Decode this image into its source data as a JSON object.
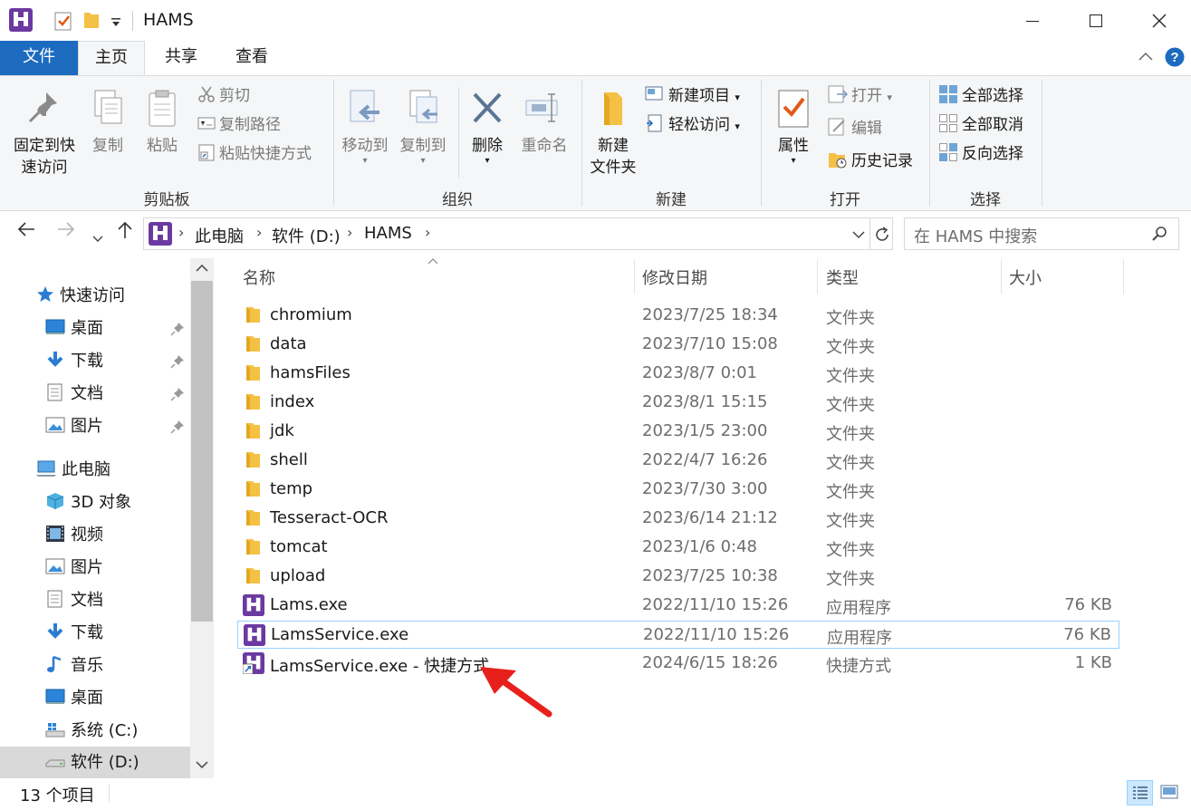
{
  "window": {
    "title": "HAMS"
  },
  "tabs": [
    {
      "label": "文件",
      "kind": "file"
    },
    {
      "label": "主页",
      "kind": "active"
    },
    {
      "label": "共享"
    },
    {
      "label": "查看"
    }
  ],
  "ribbon": {
    "clipboard": {
      "label": "剪贴板",
      "pin_line1": "固定到快",
      "pin_line2": "速访问",
      "copy": "复制",
      "paste": "粘贴",
      "cut": "剪切",
      "copy_path": "复制路径",
      "paste_shortcut": "粘贴快捷方式"
    },
    "organize": {
      "label": "组织",
      "move_to": "移动到",
      "copy_to": "复制到",
      "delete": "删除",
      "rename": "重命名"
    },
    "new": {
      "label": "新建",
      "new_folder_line1": "新建",
      "new_folder_line2": "文件夹",
      "new_item": "新建项目",
      "easy_access": "轻松访问"
    },
    "open": {
      "label": "打开",
      "properties": "属性",
      "open": "打开",
      "edit": "编辑",
      "history": "历史记录"
    },
    "select": {
      "label": "选择",
      "select_all": "全部选择",
      "select_none": "全部取消",
      "invert": "反向选择"
    }
  },
  "address": {
    "crumbs": [
      "此电脑",
      "软件 (D:)",
      "HAMS"
    ],
    "search_placeholder": "在 HAMS 中搜索"
  },
  "nav": {
    "quick_access": "快速访问",
    "quick_items": [
      "桌面",
      "下载",
      "文档",
      "图片"
    ],
    "this_pc": "此电脑",
    "pc_items": [
      "3D 对象",
      "视频",
      "图片",
      "文档",
      "下载",
      "音乐",
      "桌面",
      "系统 (C:)",
      "软件 (D:)"
    ]
  },
  "columns": {
    "name": "名称",
    "date": "修改日期",
    "type": "类型",
    "size": "大小"
  },
  "files": [
    {
      "name": "chromium",
      "date": "2023/7/25 18:34",
      "type": "文件夹",
      "size": "",
      "icon": "folder-icon"
    },
    {
      "name": "data",
      "date": "2023/7/10 15:08",
      "type": "文件夹",
      "size": "",
      "icon": "folder-icon"
    },
    {
      "name": "hamsFiles",
      "date": "2023/8/7 0:01",
      "type": "文件夹",
      "size": "",
      "icon": "folder-icon"
    },
    {
      "name": "index",
      "date": "2023/8/1 15:15",
      "type": "文件夹",
      "size": "",
      "icon": "folder-icon"
    },
    {
      "name": "jdk",
      "date": "2023/1/5 23:00",
      "type": "文件夹",
      "size": "",
      "icon": "folder-icon"
    },
    {
      "name": "shell",
      "date": "2022/4/7 16:26",
      "type": "文件夹",
      "size": "",
      "icon": "folder-icon"
    },
    {
      "name": "temp",
      "date": "2023/7/30 3:00",
      "type": "文件夹",
      "size": "",
      "icon": "folder-icon"
    },
    {
      "name": "Tesseract-OCR",
      "date": "2023/6/14 21:12",
      "type": "文件夹",
      "size": "",
      "icon": "folder-icon"
    },
    {
      "name": "tomcat",
      "date": "2023/1/6 0:48",
      "type": "文件夹",
      "size": "",
      "icon": "folder-icon"
    },
    {
      "name": "upload",
      "date": "2023/7/25 10:38",
      "type": "文件夹",
      "size": "",
      "icon": "folder-icon"
    },
    {
      "name": "Lams.exe",
      "date": "2022/11/10 15:26",
      "type": "应用程序",
      "size": "76 KB",
      "icon": "app-icon"
    },
    {
      "name": "LamsService.exe",
      "date": "2022/11/10 15:26",
      "type": "应用程序",
      "size": "76 KB",
      "icon": "app-icon"
    },
    {
      "name": "LamsService.exe - 快捷方式",
      "date": "2024/6/15 18:26",
      "type": "快捷方式",
      "size": "1 KB",
      "icon": "shortcut-icon"
    }
  ],
  "status": {
    "count": "13 个项目"
  },
  "colors": {
    "accent": "#1c6bbf",
    "folder": "#f4c145",
    "brand": "#6b3aa0",
    "arrow": "#e8201c"
  }
}
